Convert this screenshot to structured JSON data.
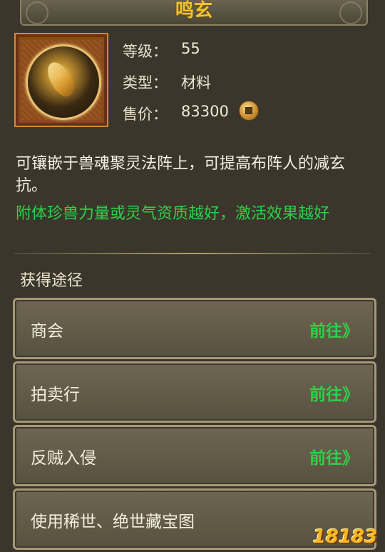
{
  "item": {
    "name": "鸣玄",
    "level_label": "等级：",
    "level_value": "55",
    "type_label": "类型：",
    "type_value": "材料",
    "price_label": "售价：",
    "price_value": "83300",
    "price_icon": "copper-coin-icon"
  },
  "description": "可镶嵌于兽魂聚灵法阵上，可提高布阵人的减玄抗。",
  "effect_note": "附体珍兽力量或灵气资质越好，激活效果越好",
  "obtain": {
    "title": "获得途径",
    "routes": [
      {
        "label": "商会",
        "action": "前往》"
      },
      {
        "label": "拍卖行",
        "action": "前往》"
      },
      {
        "label": "反贼入侵",
        "action": "前往》"
      },
      {
        "label": "使用稀世、绝世藏宝图",
        "action": ""
      }
    ]
  },
  "watermark": "18183",
  "colors": {
    "title": "#f2c230",
    "go": "#2fd04a",
    "text": "#f4f0e4"
  }
}
